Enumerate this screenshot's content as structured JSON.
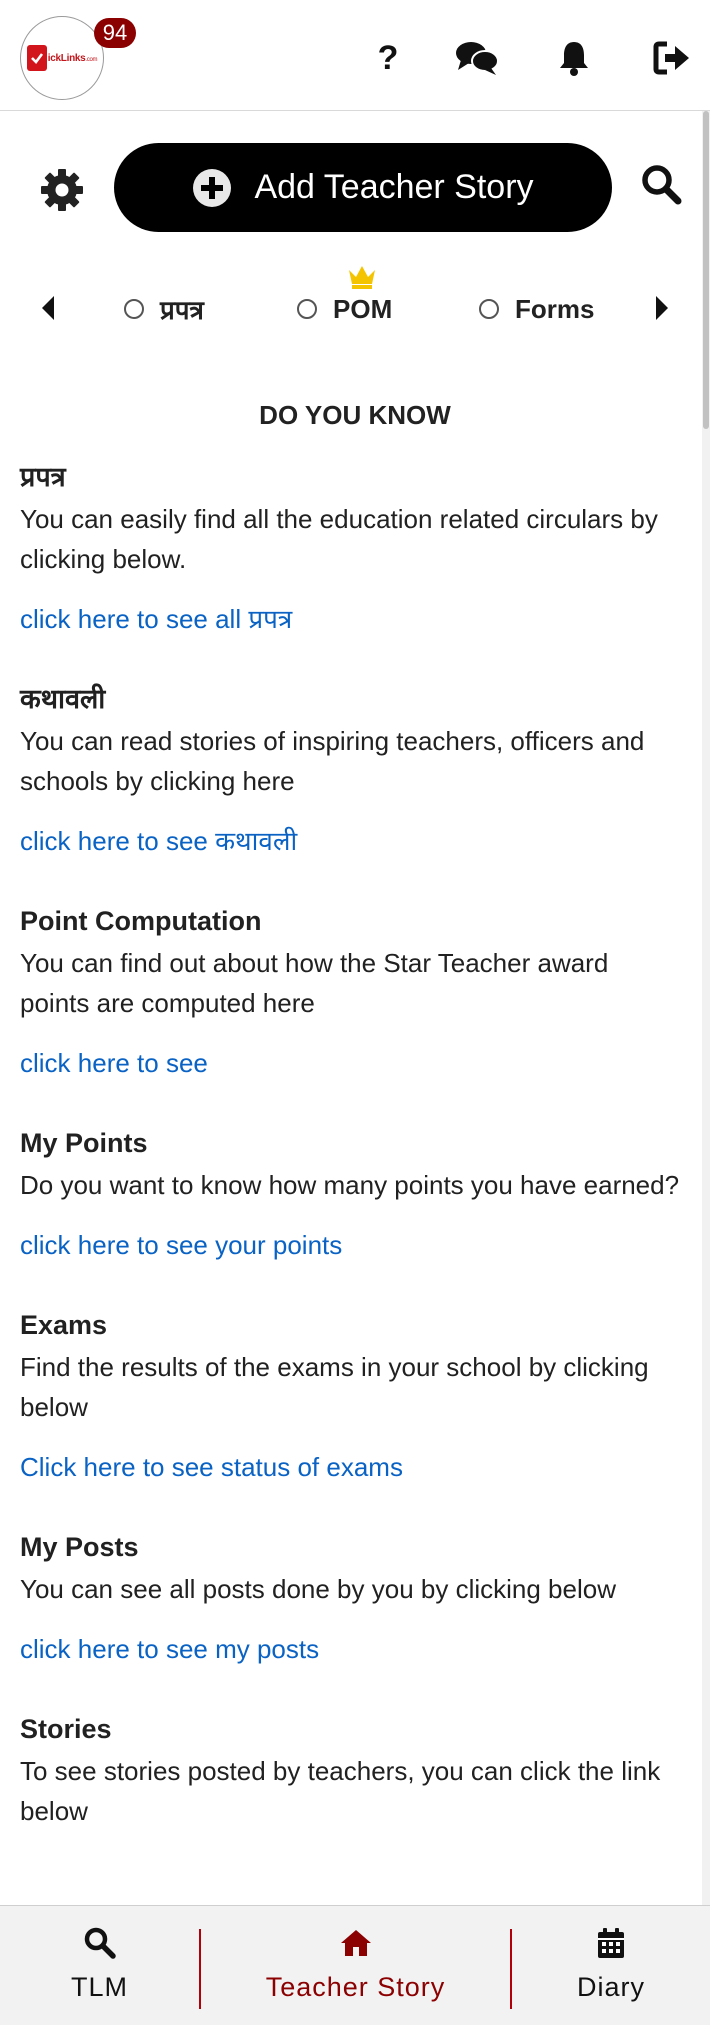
{
  "header": {
    "logo_text": "ickLinks",
    "logo_suffix": ".com",
    "badge_count": "94",
    "icons": [
      "help-icon",
      "chat-icon",
      "bell-icon",
      "logout-icon"
    ],
    "help_glyph": "?"
  },
  "toolbar": {
    "add_story_label": "Add Teacher Story",
    "icons": [
      "gear-icon",
      "plus-circle-icon",
      "search-icon"
    ]
  },
  "filters": {
    "options": [
      {
        "label": "प्रपत्र",
        "checked": false
      },
      {
        "label": "POM",
        "checked": false,
        "crown": true
      },
      {
        "label": "Forms",
        "checked": false
      }
    ]
  },
  "main": {
    "title": "DO YOU KNOW",
    "sections": [
      {
        "title": "प्रपत्र",
        "description": "You can easily find all the education related circulars by clicking below.",
        "link": "click here to see all प्रपत्र"
      },
      {
        "title": "कथावली",
        "description": "You can read stories of inspiring teachers, officers and schools by clicking here",
        "link": "click here to see कथावली"
      },
      {
        "title": "Point Computation",
        "description": "You can find out about how the Star Teacher award points are computed here",
        "link": "click here to see"
      },
      {
        "title": "My Points",
        "description": "Do you want to know how many points you have earned?",
        "link": "click here to see your points"
      },
      {
        "title": "Exams",
        "description": "Find the results of the exams in your school by clicking below",
        "link": "Click here to see status of exams"
      },
      {
        "title": "My Posts",
        "description": "You can see all posts done by you by clicking below",
        "link": "click here to see my posts"
      },
      {
        "title": "Stories",
        "description": "To see stories posted by teachers, you can click the link below",
        "link": ""
      }
    ]
  },
  "bottom_nav": {
    "items": [
      {
        "label": "TLM",
        "icon": "search-icon",
        "active": false
      },
      {
        "label": "Teacher Story",
        "icon": "home-icon",
        "active": true
      },
      {
        "label": "Diary",
        "icon": "calendar-icon",
        "active": false
      }
    ]
  },
  "colors": {
    "accent": "#8b0000",
    "link": "#0a63c4",
    "button_bg": "#000000",
    "crown": "#f5c400"
  }
}
